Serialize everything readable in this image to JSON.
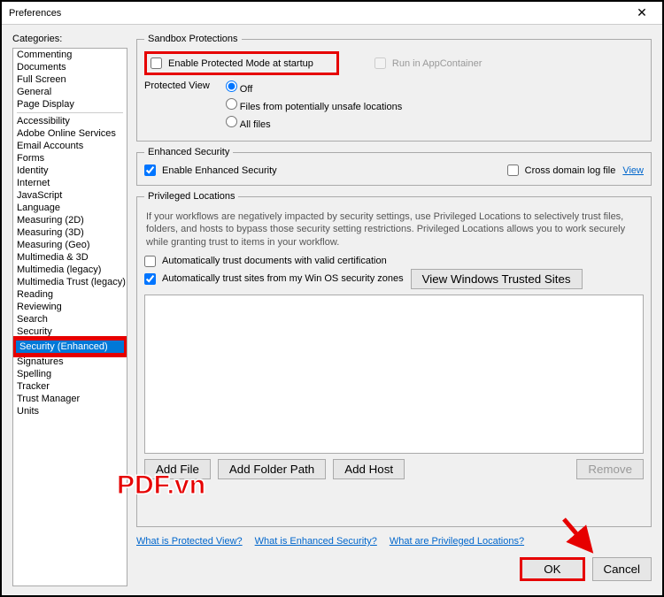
{
  "title": "Preferences",
  "categories_label": "Categories:",
  "categories_group1": [
    "Commenting",
    "Documents",
    "Full Screen",
    "General",
    "Page Display"
  ],
  "categories_group2": [
    "Accessibility",
    "Adobe Online Services",
    "Email Accounts",
    "Forms",
    "Identity",
    "Internet",
    "JavaScript",
    "Language",
    "Measuring (2D)",
    "Measuring (3D)",
    "Measuring (Geo)",
    "Multimedia & 3D",
    "Multimedia (legacy)",
    "Multimedia Trust (legacy)",
    "Reading",
    "Reviewing",
    "Search",
    "Security",
    "Security (Enhanced)",
    "Signatures",
    "Spelling",
    "Tracker",
    "Trust Manager",
    "Units"
  ],
  "selected_category": "Security (Enhanced)",
  "sandbox": {
    "legend": "Sandbox Protections",
    "enable_protected": "Enable Protected Mode at startup",
    "run_appcontainer": "Run in AppContainer",
    "protected_view_label": "Protected View",
    "pv_off": "Off",
    "pv_unsafe": "Files from potentially unsafe locations",
    "pv_all": "All files"
  },
  "enhanced": {
    "legend": "Enhanced Security",
    "enable": "Enable Enhanced Security",
    "cross_domain": "Cross domain log file",
    "view": "View"
  },
  "priv": {
    "legend": "Privileged Locations",
    "desc": "If your workflows are negatively impacted by security settings, use Privileged Locations to selectively trust files, folders, and hosts to bypass those security setting restrictions. Privileged Locations allows you to work securely while granting trust to items in your workflow.",
    "auto_cert": "Automatically trust documents with valid certification",
    "auto_zones": "Automatically trust sites from my Win OS security zones",
    "view_trusted": "View Windows Trusted Sites",
    "add_file": "Add File",
    "add_folder": "Add Folder Path",
    "add_host": "Add Host",
    "remove": "Remove"
  },
  "links": {
    "pv": "What is Protected View?",
    "es": "What is Enhanced Security?",
    "pl": "What are Privileged Locations?"
  },
  "ok": "OK",
  "cancel": "Cancel",
  "watermark": "PDF.vn"
}
